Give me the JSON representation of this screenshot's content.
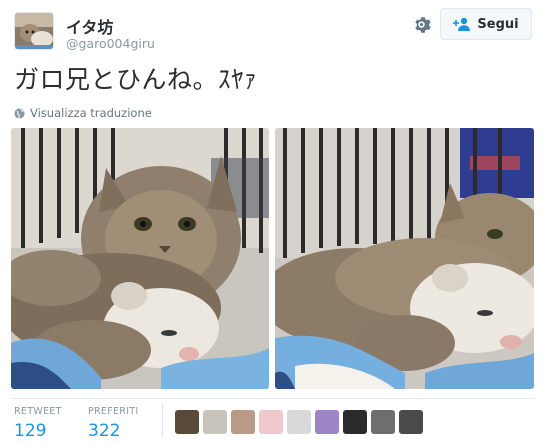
{
  "user": {
    "display_name": "イタ坊",
    "handle": "@garo004giru",
    "avatar_icon": "cat-ferret-avatar"
  },
  "actions": {
    "settings_icon": "gear-icon",
    "follow_label": "Segui",
    "follow_icon": "add-user-icon"
  },
  "tweet": {
    "text": "ガロ兄とひんね。ｽﾔｧ",
    "translate_label": "Visualizza traduzione"
  },
  "media": [
    {
      "name": "photo-cat-ferret-1"
    },
    {
      "name": "photo-cat-ferret-2"
    }
  ],
  "stats": {
    "retweet_label": "RETWEET",
    "retweet_count": "129",
    "likes_label": "PREFERITI",
    "likes_count": "322"
  },
  "likers": [
    {
      "name": "liker-avatar-1",
      "color": "#5a4a3a"
    },
    {
      "name": "liker-avatar-2",
      "color": "#c9c4bb"
    },
    {
      "name": "liker-avatar-3",
      "color": "#b89a86"
    },
    {
      "name": "liker-avatar-4",
      "color": "#f0c9cf"
    },
    {
      "name": "liker-avatar-5",
      "color": "#d9d9d9"
    },
    {
      "name": "liker-avatar-6",
      "color": "#9c86c9"
    },
    {
      "name": "liker-avatar-7",
      "color": "#2a2a2a"
    },
    {
      "name": "liker-avatar-8",
      "color": "#6e6e6e"
    },
    {
      "name": "liker-avatar-9",
      "color": "#4a4a4a"
    }
  ],
  "colors": {
    "link": "#1b95e0",
    "muted": "#8899a6",
    "text": "#292f33",
    "border": "#e1e8ed"
  }
}
